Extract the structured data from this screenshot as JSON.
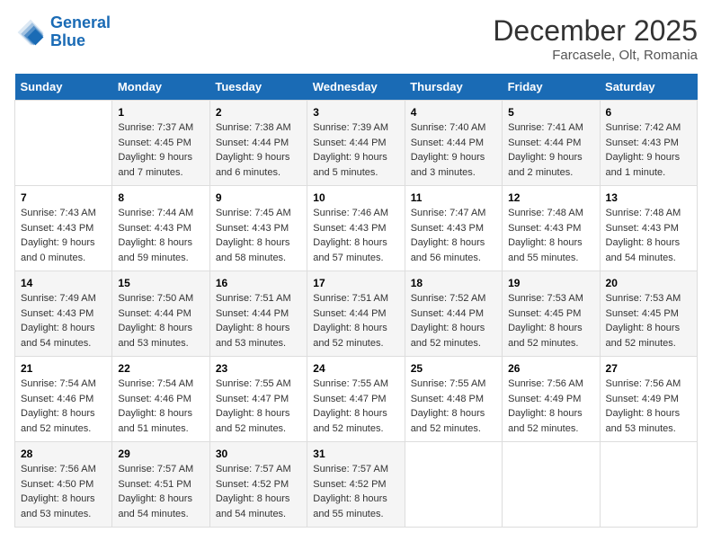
{
  "header": {
    "logo_line1": "General",
    "logo_line2": "Blue",
    "month": "December 2025",
    "location": "Farcasele, Olt, Romania"
  },
  "weekdays": [
    "Sunday",
    "Monday",
    "Tuesday",
    "Wednesday",
    "Thursday",
    "Friday",
    "Saturday"
  ],
  "weeks": [
    [
      {
        "day": "",
        "info": ""
      },
      {
        "day": "1",
        "info": "Sunrise: 7:37 AM\nSunset: 4:45 PM\nDaylight: 9 hours\nand 7 minutes."
      },
      {
        "day": "2",
        "info": "Sunrise: 7:38 AM\nSunset: 4:44 PM\nDaylight: 9 hours\nand 6 minutes."
      },
      {
        "day": "3",
        "info": "Sunrise: 7:39 AM\nSunset: 4:44 PM\nDaylight: 9 hours\nand 5 minutes."
      },
      {
        "day": "4",
        "info": "Sunrise: 7:40 AM\nSunset: 4:44 PM\nDaylight: 9 hours\nand 3 minutes."
      },
      {
        "day": "5",
        "info": "Sunrise: 7:41 AM\nSunset: 4:44 PM\nDaylight: 9 hours\nand 2 minutes."
      },
      {
        "day": "6",
        "info": "Sunrise: 7:42 AM\nSunset: 4:43 PM\nDaylight: 9 hours\nand 1 minute."
      }
    ],
    [
      {
        "day": "7",
        "info": "Sunrise: 7:43 AM\nSunset: 4:43 PM\nDaylight: 9 hours\nand 0 minutes."
      },
      {
        "day": "8",
        "info": "Sunrise: 7:44 AM\nSunset: 4:43 PM\nDaylight: 8 hours\nand 59 minutes."
      },
      {
        "day": "9",
        "info": "Sunrise: 7:45 AM\nSunset: 4:43 PM\nDaylight: 8 hours\nand 58 minutes."
      },
      {
        "day": "10",
        "info": "Sunrise: 7:46 AM\nSunset: 4:43 PM\nDaylight: 8 hours\nand 57 minutes."
      },
      {
        "day": "11",
        "info": "Sunrise: 7:47 AM\nSunset: 4:43 PM\nDaylight: 8 hours\nand 56 minutes."
      },
      {
        "day": "12",
        "info": "Sunrise: 7:48 AM\nSunset: 4:43 PM\nDaylight: 8 hours\nand 55 minutes."
      },
      {
        "day": "13",
        "info": "Sunrise: 7:48 AM\nSunset: 4:43 PM\nDaylight: 8 hours\nand 54 minutes."
      }
    ],
    [
      {
        "day": "14",
        "info": "Sunrise: 7:49 AM\nSunset: 4:43 PM\nDaylight: 8 hours\nand 54 minutes."
      },
      {
        "day": "15",
        "info": "Sunrise: 7:50 AM\nSunset: 4:44 PM\nDaylight: 8 hours\nand 53 minutes."
      },
      {
        "day": "16",
        "info": "Sunrise: 7:51 AM\nSunset: 4:44 PM\nDaylight: 8 hours\nand 53 minutes."
      },
      {
        "day": "17",
        "info": "Sunrise: 7:51 AM\nSunset: 4:44 PM\nDaylight: 8 hours\nand 52 minutes."
      },
      {
        "day": "18",
        "info": "Sunrise: 7:52 AM\nSunset: 4:44 PM\nDaylight: 8 hours\nand 52 minutes."
      },
      {
        "day": "19",
        "info": "Sunrise: 7:53 AM\nSunset: 4:45 PM\nDaylight: 8 hours\nand 52 minutes."
      },
      {
        "day": "20",
        "info": "Sunrise: 7:53 AM\nSunset: 4:45 PM\nDaylight: 8 hours\nand 52 minutes."
      }
    ],
    [
      {
        "day": "21",
        "info": "Sunrise: 7:54 AM\nSunset: 4:46 PM\nDaylight: 8 hours\nand 52 minutes."
      },
      {
        "day": "22",
        "info": "Sunrise: 7:54 AM\nSunset: 4:46 PM\nDaylight: 8 hours\nand 51 minutes."
      },
      {
        "day": "23",
        "info": "Sunrise: 7:55 AM\nSunset: 4:47 PM\nDaylight: 8 hours\nand 52 minutes."
      },
      {
        "day": "24",
        "info": "Sunrise: 7:55 AM\nSunset: 4:47 PM\nDaylight: 8 hours\nand 52 minutes."
      },
      {
        "day": "25",
        "info": "Sunrise: 7:55 AM\nSunset: 4:48 PM\nDaylight: 8 hours\nand 52 minutes."
      },
      {
        "day": "26",
        "info": "Sunrise: 7:56 AM\nSunset: 4:49 PM\nDaylight: 8 hours\nand 52 minutes."
      },
      {
        "day": "27",
        "info": "Sunrise: 7:56 AM\nSunset: 4:49 PM\nDaylight: 8 hours\nand 53 minutes."
      }
    ],
    [
      {
        "day": "28",
        "info": "Sunrise: 7:56 AM\nSunset: 4:50 PM\nDaylight: 8 hours\nand 53 minutes."
      },
      {
        "day": "29",
        "info": "Sunrise: 7:57 AM\nSunset: 4:51 PM\nDaylight: 8 hours\nand 54 minutes."
      },
      {
        "day": "30",
        "info": "Sunrise: 7:57 AM\nSunset: 4:52 PM\nDaylight: 8 hours\nand 54 minutes."
      },
      {
        "day": "31",
        "info": "Sunrise: 7:57 AM\nSunset: 4:52 PM\nDaylight: 8 hours\nand 55 minutes."
      },
      {
        "day": "",
        "info": ""
      },
      {
        "day": "",
        "info": ""
      },
      {
        "day": "",
        "info": ""
      }
    ]
  ]
}
